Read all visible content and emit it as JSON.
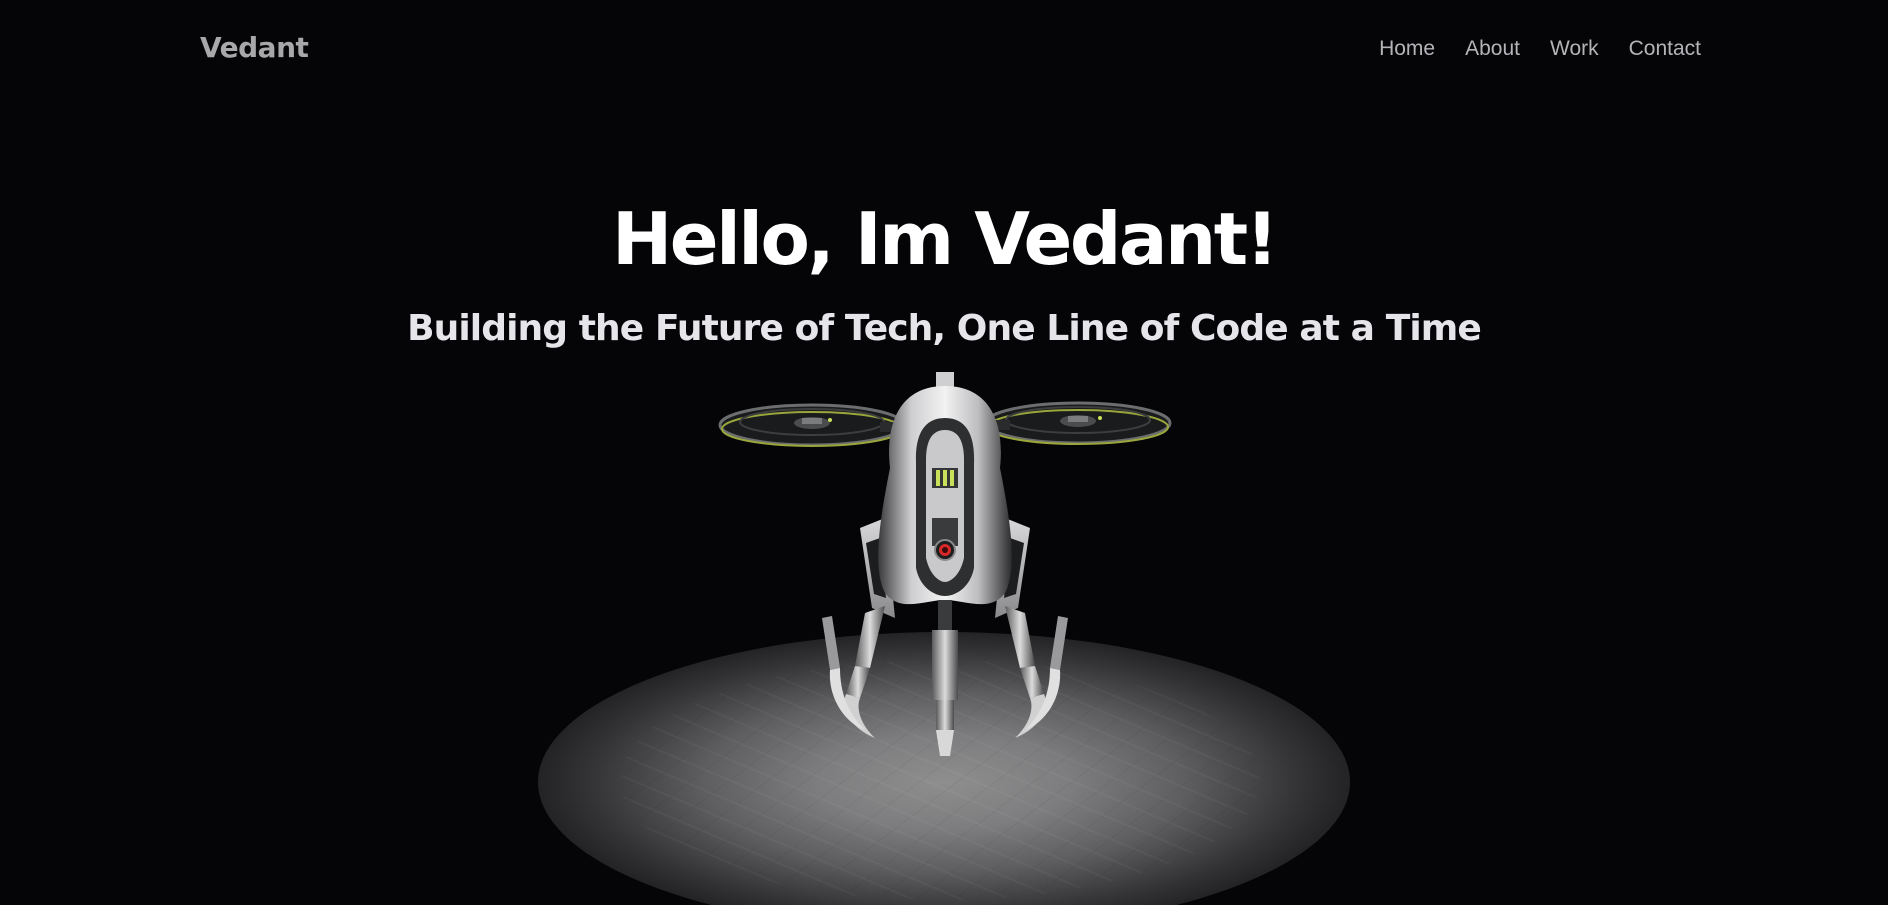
{
  "header": {
    "logo": "Vedant",
    "nav": [
      {
        "label": "Home"
      },
      {
        "label": "About"
      },
      {
        "label": "Work"
      },
      {
        "label": "Contact"
      }
    ]
  },
  "hero": {
    "title": "Hello, Im Vedant!",
    "subtitle": "Building the Future of Tech, One Line of Code at a Time"
  },
  "scene": {
    "model": "drone-robot",
    "background_color": "#050507",
    "spotlight_color": "#8e8e8e",
    "accent_color": "#c8e05a",
    "eye_color": "#d62828"
  }
}
